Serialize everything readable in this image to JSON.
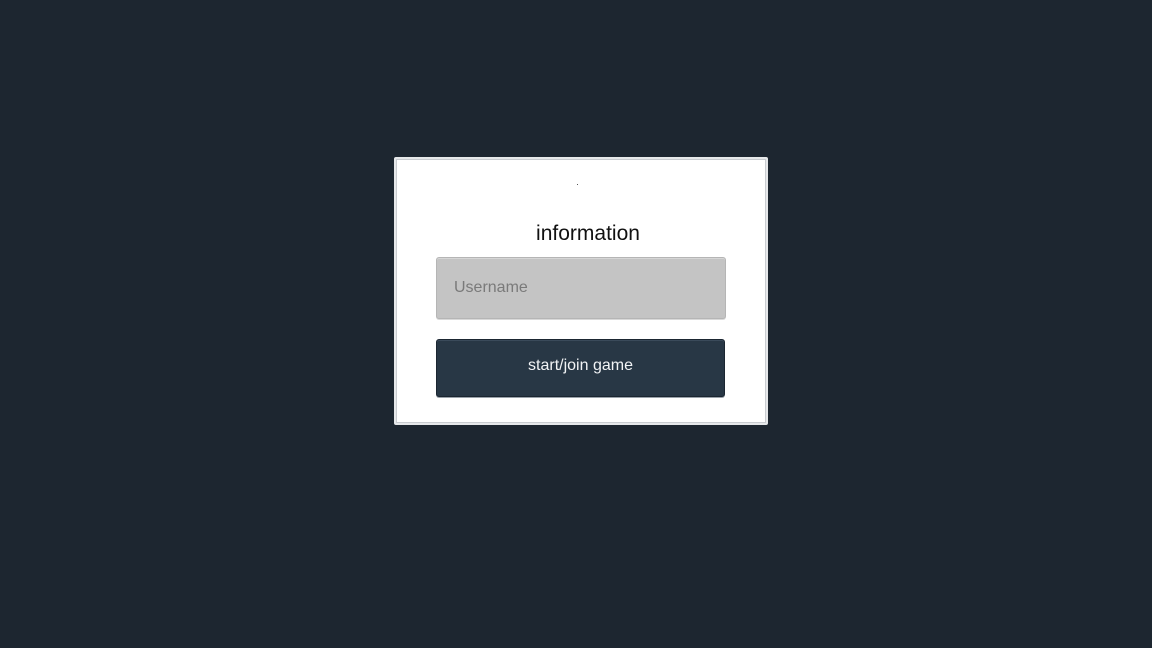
{
  "panel": {
    "title": "information"
  },
  "username_field": {
    "placeholder": "Username",
    "value": ""
  },
  "start_button": {
    "label": "start/join game"
  },
  "colors": {
    "background": "#1d2630",
    "panel": "#ffffff",
    "input": "#c4c4c4",
    "button": "#283745",
    "button_text": "#f2f4f6"
  }
}
